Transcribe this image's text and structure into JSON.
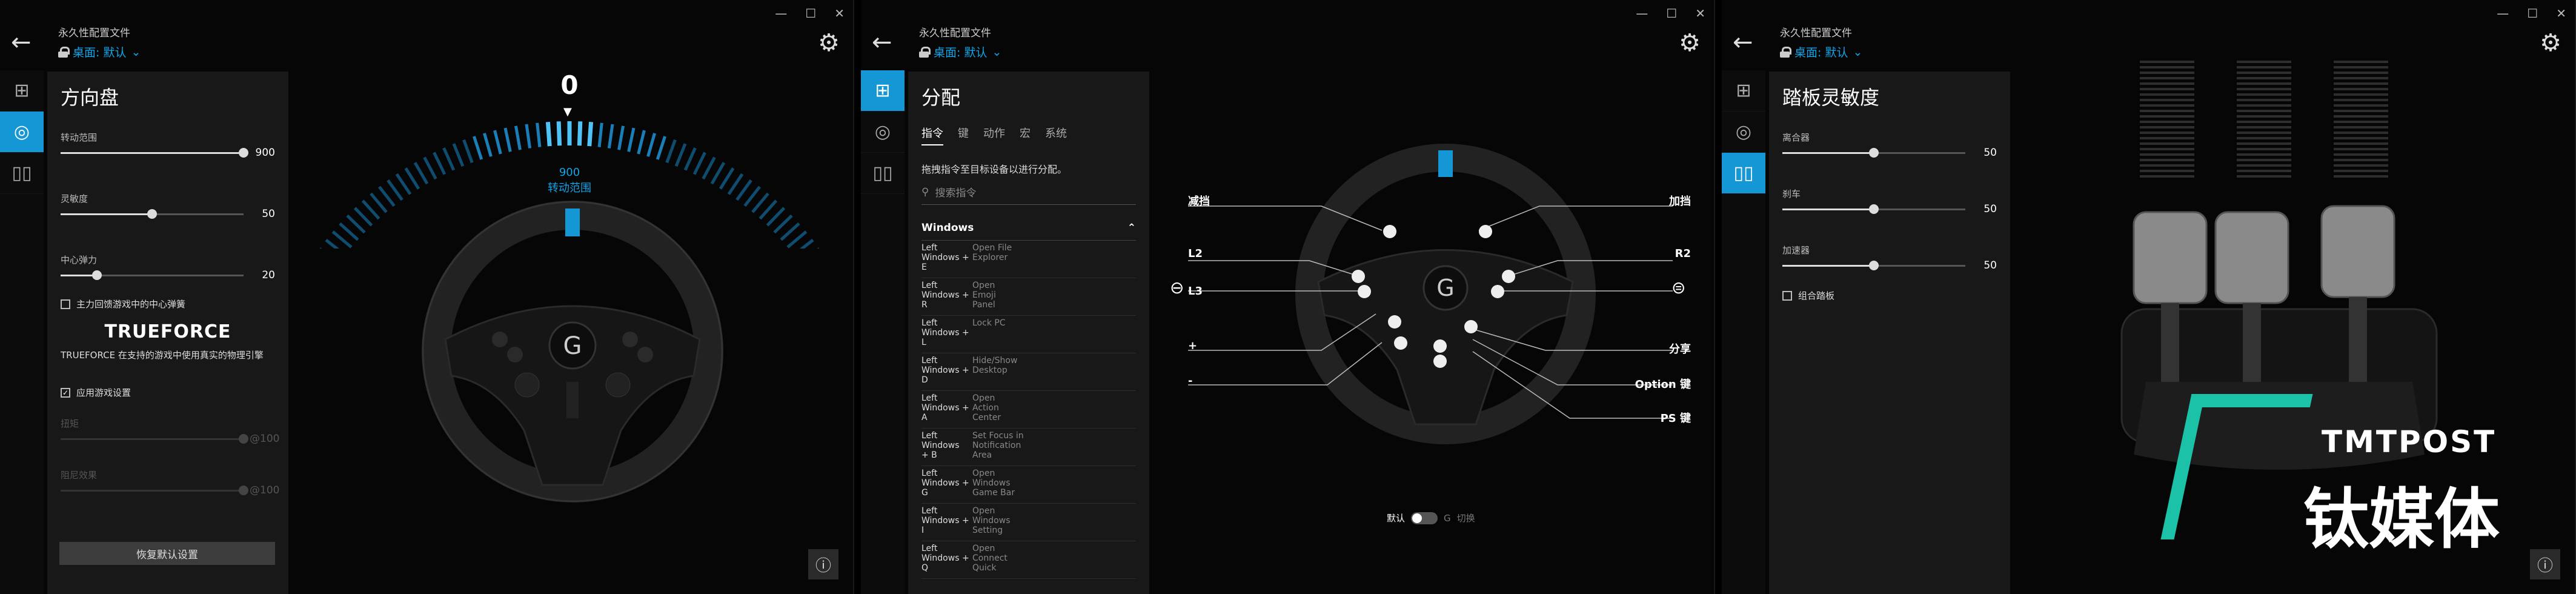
{
  "profile": {
    "title": "永久性配置文件",
    "name": "桌面: 默认"
  },
  "w1": {
    "title": "方向盘",
    "rotation_label": "转动范围",
    "rotation_value": "900",
    "sensitivity_label": "灵敏度",
    "sensitivity_value": "50",
    "centering_label": "中心弹力",
    "centering_value": "20",
    "centering_check": "主力回馈游戏中的中心弹簧",
    "trueforce_logo": "TRUEFORCE",
    "trueforce_desc": "TRUEFORCE 在支持的游戏中使用真实的物理引擎",
    "game_settings": "应用游戏设置",
    "strength_label": "扭矩",
    "strength_value": "@100",
    "damping_label": "阻尼效果",
    "damping_value": "@100",
    "reset": "恢复默认设置",
    "angle": "0",
    "range_value": "900",
    "range_label": "转动范围",
    "sens_pct": 0.5,
    "center_pct": 0.2
  },
  "w2": {
    "title": "分配",
    "tabs": [
      "指令",
      "键",
      "动作",
      "宏",
      "系统"
    ],
    "hint": "拖拽指令至目标设备以进行分配。",
    "search": "搜索指令",
    "category": "Windows",
    "commands": [
      {
        "key": "Left\nWindows +\nE",
        "action": "Open File\nExplorer"
      },
      {
        "key": "Left\nWindows +\nR",
        "action": "Open\nEmoji\nPanel"
      },
      {
        "key": "Left\nWindows +\nL",
        "action": "Lock PC"
      },
      {
        "key": "Left\nWindows +\nD",
        "action": "Hide/Show\nDesktop"
      },
      {
        "key": "Left\nWindows +\nA",
        "action": "Open\nAction\nCenter"
      },
      {
        "key": "Left\nWindows\n+ B",
        "action": "Set Focus in\nNotification\nArea"
      },
      {
        "key": "Left\nWindows +\nG",
        "action": "Open\nWindows\nGame Bar"
      },
      {
        "key": "Left\nWindows +\nI",
        "action": "Open\nWindows\nSetting"
      },
      {
        "key": "Left\nWindows +\nQ",
        "action": "Open\nConnect\nQuick"
      }
    ],
    "labels": {
      "down": "减挡",
      "up": "加挡",
      "l2": "L2",
      "r2": "R2",
      "l3": "L3",
      "plus": "+",
      "minus": "-",
      "share": "分享",
      "option": "Option 键",
      "ps": "PS 键"
    },
    "toggle_default": "默认",
    "toggle_switch": "切换"
  },
  "w3": {
    "title": "踏板灵敏度",
    "clutch": "离合器",
    "clutch_value": "50",
    "brake": "刹车",
    "brake_value": "50",
    "throttle": "加速器",
    "throttle_value": "50",
    "combined": "组合踏板",
    "pct": 0.5
  },
  "watermark": {
    "en": "TMTPOST",
    "cn": "钛媒体"
  }
}
